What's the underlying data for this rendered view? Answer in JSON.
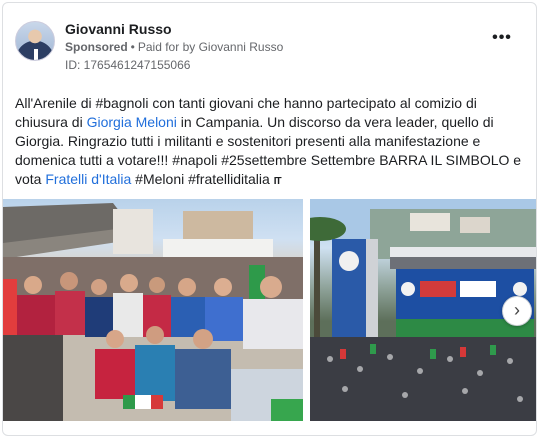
{
  "post": {
    "author": "Giovanni Russo",
    "sponsored_label": "Sponsored",
    "separator": "•",
    "paid_for": "Paid for by Giovanni Russo",
    "ad_id": "ID: 1765461247155066",
    "more_icon": "•••",
    "text": {
      "part1": "All'Arenile di #bagnoli con tanti giovani che hanno partecipato al comizio di chiusura di ",
      "link1": "Giorgia Meloni",
      "part2": " in Campania. Un discorso da vera leader, quello di Giorgia. Ringrazio tutti i militanti e sostenitori presenti alla manifestazione e domenica tutti a votare!!! #napoli #25settembre Settembre BARRA IL SIMBOLO e vota ",
      "link2": "Fratelli d'Italia",
      "part3": " #Meloni #fratelliditalia ",
      "icon": "IT"
    }
  },
  "gallery": {
    "next_icon": "›"
  },
  "colors": {
    "link": "#216fdb",
    "secondary_text": "#65676b",
    "border": "#dddfe2"
  }
}
